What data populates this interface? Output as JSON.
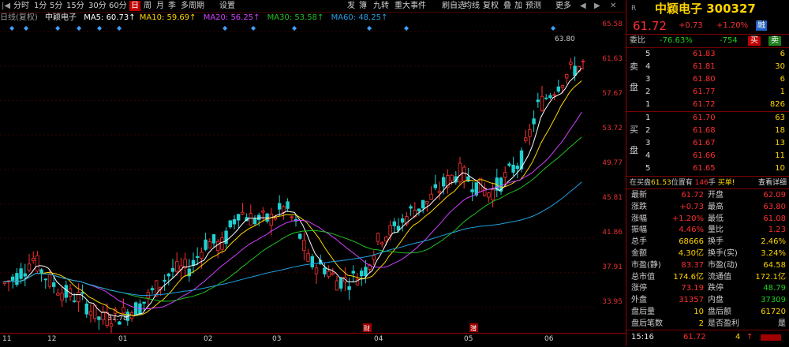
{
  "toolbar": {
    "items": [
      "分时",
      "1分",
      "5分",
      "15分",
      "30分",
      "60分",
      "日",
      "周",
      "月",
      "季",
      "多周期",
      "设置"
    ],
    "active_index": 6,
    "right_items": [
      "发",
      "簿",
      "九转",
      "重大事件",
      "刷自选",
      "均线",
      "复权",
      "叠",
      "加",
      "预测",
      "更多"
    ]
  },
  "ma_row": {
    "title": "日线(复权)",
    "name": "中颖电子",
    "ma5": "MA5: 60.73↑",
    "ma10": "MA10: 59.69↑",
    "ma20": "MA20: 56.25↑",
    "ma30": "MA30: 53.58↑",
    "ma60": "MA60: 48.25↑"
  },
  "colors": {
    "ma5": "#ffffff",
    "ma10": "#ffd400",
    "ma20": "#d040ff",
    "ma30": "#20c020",
    "ma60": "#20a0e0",
    "up": "#ff3030",
    "down": "#20d0d0"
  },
  "y_axis": [
    "65.58",
    "61.63",
    "57.67",
    "53.72",
    "49.77",
    "45.81",
    "41.86",
    "37.91",
    "33.95"
  ],
  "x_axis": [
    "11",
    "12",
    "01",
    "02",
    "03",
    "04",
    "05",
    "06"
  ],
  "annotations": {
    "high": "63.80",
    "low": "31.78",
    "markers": [
      "财",
      "潜"
    ]
  },
  "panel": {
    "header": {
      "symbol_tag": "R",
      "title": "中颖电子 300327"
    },
    "price": {
      "last": "61.72",
      "change": "+0.73",
      "pct": "+1.20%",
      "tag": "融"
    },
    "weibi": {
      "label": "委比",
      "pct": "-76.63%",
      "diff": "-754",
      "sell_btn": "买",
      "buy_btn": "卖"
    },
    "sell_label": "卖盘",
    "buy_label": "买盘",
    "asks": [
      {
        "lv": "5",
        "price": "61.83",
        "vol": "6"
      },
      {
        "lv": "4",
        "price": "61.81",
        "vol": "30"
      },
      {
        "lv": "3",
        "price": "61.80",
        "vol": "6"
      },
      {
        "lv": "2",
        "price": "61.77",
        "vol": "1"
      },
      {
        "lv": "1",
        "price": "61.72",
        "vol": "826"
      }
    ],
    "bids": [
      {
        "lv": "1",
        "price": "61.70",
        "vol": "63"
      },
      {
        "lv": "2",
        "price": "61.68",
        "vol": "18"
      },
      {
        "lv": "3",
        "price": "61.67",
        "vol": "13"
      },
      {
        "lv": "4",
        "price": "61.66",
        "vol": "11"
      },
      {
        "lv": "5",
        "price": "61.65",
        "vol": "10"
      }
    ],
    "notice": {
      "pre": "在买盘",
      "price": "61.53",
      "mid": "位置有",
      "count": "146",
      "unit": "手",
      "post": "买单!",
      "link": "查看详细"
    },
    "stats": [
      {
        "l1": "最新",
        "v1": "61.72",
        "l2": "开盘",
        "v2": "62.09"
      },
      {
        "l1": "涨跌",
        "v1": "+0.73",
        "l2": "最高",
        "v2": "63.80"
      },
      {
        "l1": "涨幅",
        "v1": "+1.20%",
        "l2": "最低",
        "v2": "61.08"
      },
      {
        "l1": "振幅",
        "v1": "4.46%",
        "l2": "量比",
        "v2": "1.23"
      },
      {
        "l1": "总手",
        "v1": "68666",
        "l2": "换手",
        "v2": "2.46%"
      },
      {
        "l1": "金额",
        "v1": "4.30亿",
        "l2": "换手(实)",
        "v2": "3.24%"
      },
      {
        "l1": "市盈(静)",
        "v1": "83.37",
        "l2": "市盈(动)",
        "v2": "64.58"
      },
      {
        "l1": "总市值",
        "v1": "174.6亿",
        "l2": "流通值",
        "v2": "172.1亿"
      },
      {
        "l1": "涨停",
        "v1": "73.19",
        "l2": "跌停",
        "v2": "48.79"
      },
      {
        "l1": "外盘",
        "v1": "31357",
        "l2": "内盘",
        "v2": "37309"
      },
      {
        "l1": "盘后量",
        "v1": "10",
        "l2": "盘后额",
        "v2": "61720"
      },
      {
        "l1": "盘后笔数",
        "v1": "2",
        "l2": "是否盈利",
        "v2": "是"
      }
    ],
    "tick": {
      "time": "15:16",
      "price": "61.72",
      "vol": "4",
      "dir": "↑"
    }
  }
}
